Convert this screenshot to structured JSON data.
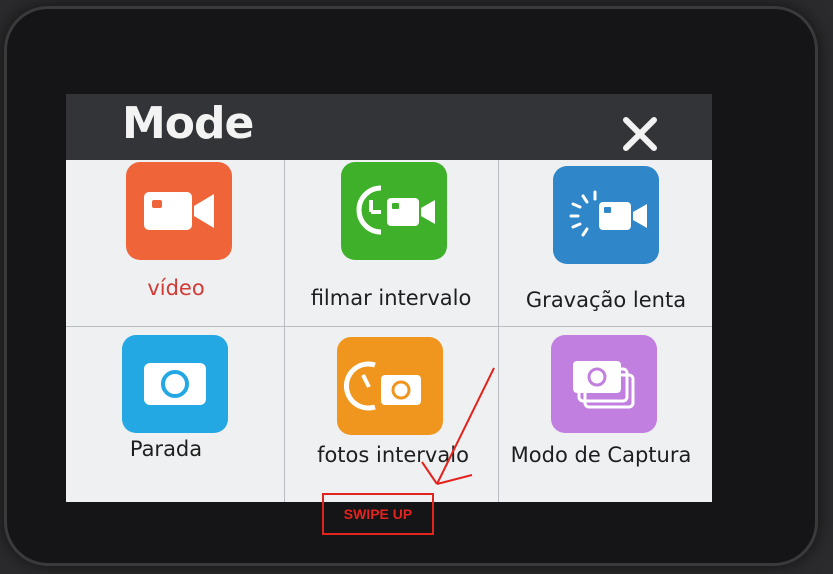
{
  "header": {
    "title": "Mode"
  },
  "modes": [
    {
      "label": "vídeo",
      "icon": "video-camera-icon",
      "color": "#f0643a",
      "selected": true
    },
    {
      "label": "filmar intervalo",
      "icon": "timelapse-video-icon",
      "color": "#3fb02a",
      "selected": false
    },
    {
      "label": "Gravação lenta",
      "icon": "slow-motion-video-icon",
      "color": "#2f86c8",
      "selected": false
    },
    {
      "label": "Parada",
      "icon": "photo-camera-icon",
      "color": "#24a8e4",
      "selected": false
    },
    {
      "label": "fotos intervalo",
      "icon": "timelapse-photo-icon",
      "color": "#f0961e",
      "selected": false
    },
    {
      "label": "Modo de Captura",
      "icon": "burst-photo-icon",
      "color": "#c17fe0",
      "selected": false
    }
  ],
  "annotation": {
    "text": "SWIPE UP",
    "color": "#e3231d"
  },
  "colors": {
    "header_bg": "#333438",
    "screen_bg": "#eef0f2",
    "selected_label": "#d23a36"
  }
}
